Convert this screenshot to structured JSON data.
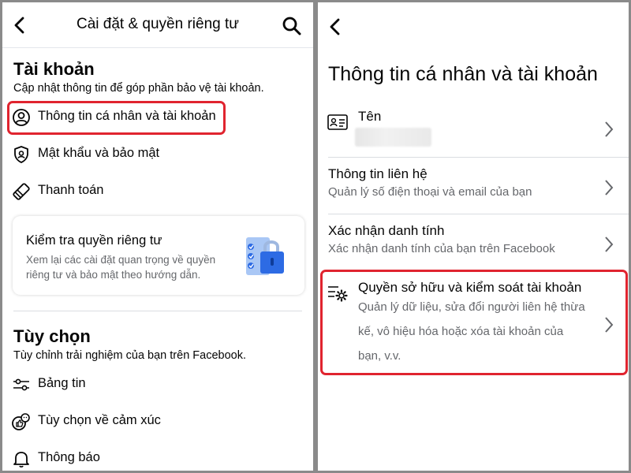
{
  "left": {
    "header": {
      "title": "Cài đặt & quyền riêng tư"
    },
    "account": {
      "title": "Tài khoản",
      "subtitle": "Cập nhật thông tin để góp phần bảo vệ tài khoản.",
      "items": [
        {
          "label": "Thông tin cá nhân và tài khoản",
          "icon": "user-circle-icon"
        },
        {
          "label": "Mật khẩu và bảo mật",
          "icon": "shield-icon"
        },
        {
          "label": "Thanh toán",
          "icon": "tag-icon"
        }
      ]
    },
    "privacy_card": {
      "title": "Kiểm tra quyền riêng tư",
      "description": "Xem lại các cài đặt quan trọng về quyền riêng tư và bảo mật theo hướng dẫn.",
      "icon": "privacy-lock-checklist-icon"
    },
    "preferences": {
      "title": "Tùy chọn",
      "subtitle": "Tùy chỉnh trải nghiệm của bạn trên Facebook.",
      "items": [
        {
          "label": "Bảng tin",
          "icon": "sliders-icon"
        },
        {
          "label": "Tùy chọn về cảm xúc",
          "icon": "reactions-icon"
        },
        {
          "label": "Thông báo",
          "icon": "bell-icon"
        }
      ]
    }
  },
  "right": {
    "title": "Thông tin cá nhân và tài khoản",
    "items": [
      {
        "title": "Tên",
        "icon": "id-card-icon"
      },
      {
        "title": "Thông tin liên hệ",
        "description": "Quản lý số điện thoại và email của bạn"
      },
      {
        "title": "Xác nhận danh tính",
        "description": "Xác nhận danh tính của bạn trên Facebook"
      },
      {
        "title": "Quyền sở hữu và kiểm soát tài khoản",
        "description_lines": [
          "Quản lý dữ liệu, sửa đổi người liên hệ thừa",
          "kế, vô hiệu hóa hoặc xóa tài khoản của",
          "bạn, v.v."
        ],
        "icon": "list-gear-icon"
      }
    ]
  },
  "colors": {
    "highlight": "#e0242f",
    "text": "#050505",
    "secondary_text": "#65676b",
    "lock_blue": "#2d6be4"
  }
}
